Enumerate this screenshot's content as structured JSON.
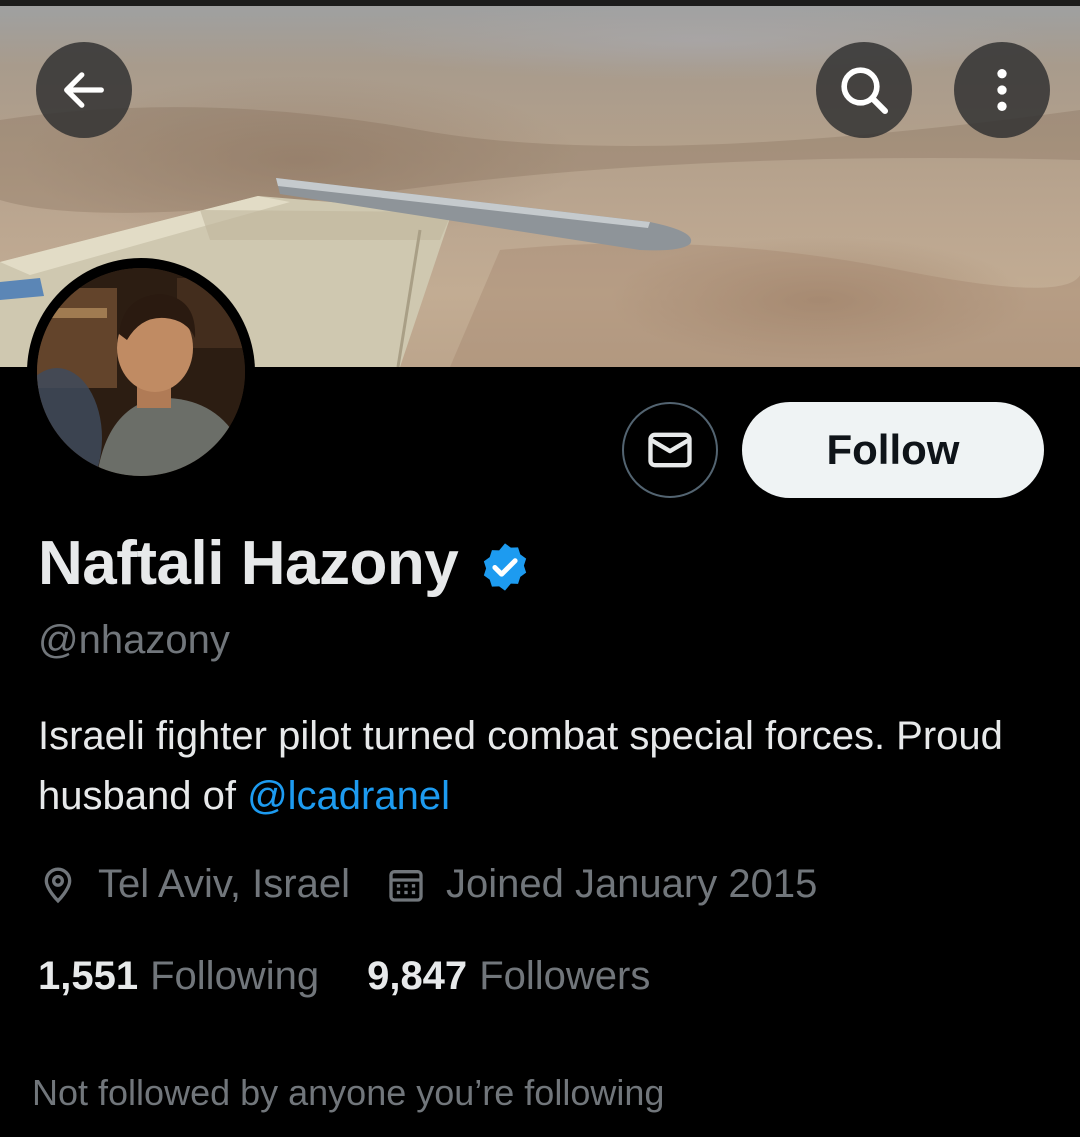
{
  "header": {
    "back_icon": "arrow-left-icon",
    "search_icon": "search-icon",
    "more_icon": "more-vertical-icon"
  },
  "profile": {
    "display_name": "Naftali Hazony",
    "verified_icon": "verified-badge-icon",
    "verified_color": "#1d9bf0",
    "handle": "@nhazony",
    "bio_text": "Israeli fighter pilot turned combat special forces. Proud husband of ",
    "bio_mention": "@lcadranel",
    "location": "Tel Aviv, Israel",
    "joined": "Joined January 2015",
    "following_count": "1,551",
    "following_label": "Following",
    "followers_count": "9,847",
    "followers_label": "Followers",
    "social_context": "Not followed by anyone you’re following"
  },
  "actions": {
    "message_icon": "mail-icon",
    "follow_label": "Follow"
  },
  "colors": {
    "background": "#000000",
    "accent": "#1d9bf0",
    "muted_text": "#71767b",
    "primary_text": "#e7e9ea"
  }
}
